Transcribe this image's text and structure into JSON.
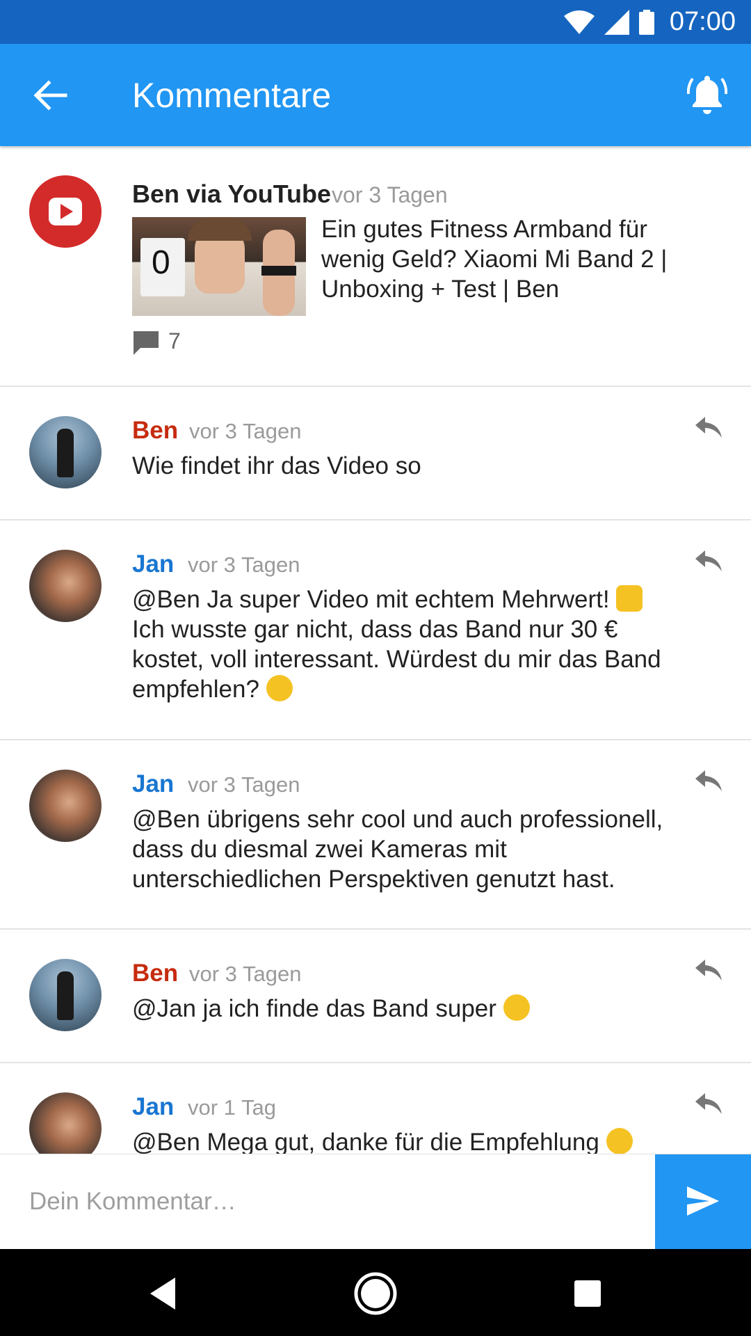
{
  "status_bar": {
    "time": "07:00",
    "icons": [
      "wifi-icon",
      "signal-icon",
      "battery-icon"
    ]
  },
  "app_bar": {
    "title": "Kommentare",
    "icons": [
      "arrow-back-icon",
      "notification-bell-icon"
    ]
  },
  "post": {
    "author": "Ben via YouTube",
    "time": "vor 3 Tagen",
    "video_title": "Ein gutes Fitness Armband für wenig Geld? Xiaomi Mi Band 2 | Unboxing + Test | Ben",
    "comment_count": "7",
    "thumbnail_text": "0"
  },
  "comments": [
    {
      "author": "Ben",
      "time": "vor 3 Tagen",
      "text": "Wie findet ihr das Video so"
    },
    {
      "author": "Jan",
      "time": "vor 3 Tagen",
      "text": "@Ben Ja super Video mit echtem Mehrwert!",
      "text2": " Ich wusste gar nicht, dass das Band nur 30 € kostet, voll interessant. Würdest du mir das Band empfehlen? "
    },
    {
      "author": "Jan",
      "time": "vor 3 Tagen",
      "text": "@Ben übrigens sehr cool und auch profes­sionell, dass du diesmal zwei Kameras mit unterschiedlichen Perspektiven genutzt hast."
    },
    {
      "author": "Ben",
      "time": "vor 3 Tagen",
      "text": "@Jan ja ich finde das Band super "
    },
    {
      "author": "Jan",
      "time": "vor 1 Tag",
      "text": "@Ben Mega gut, danke für die Empfehlung "
    }
  ],
  "input": {
    "placeholder": "Dein Kommentar…"
  },
  "colors": {
    "status_bar": "#1565c0",
    "app_bar": "#2196f3",
    "name_ben": "#c62b0e",
    "name_jan": "#1976d2",
    "send_button": "#2196f3"
  }
}
